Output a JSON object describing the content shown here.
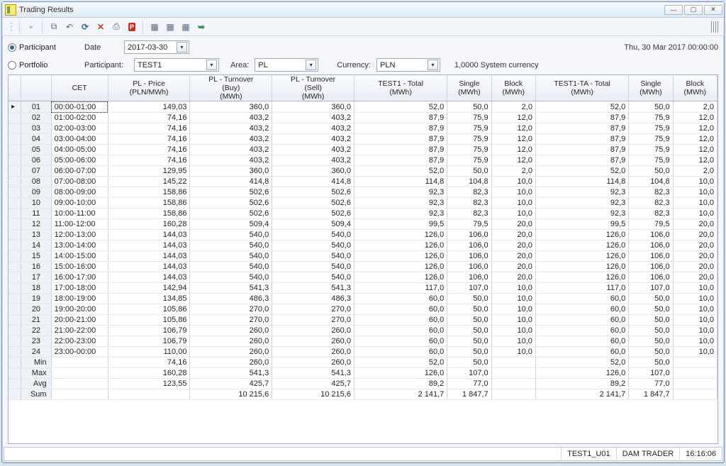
{
  "window": {
    "title": "Trading Results"
  },
  "toolbar": {
    "icons": [
      {
        "name": "new-page-icon",
        "glyph": "▫"
      },
      {
        "name": "copy-icon",
        "glyph": "⧉"
      },
      {
        "name": "undo-icon",
        "glyph": "↶"
      },
      {
        "name": "refresh-icon",
        "glyph": "⟳"
      },
      {
        "name": "delete-icon",
        "glyph": "✕"
      },
      {
        "name": "print-icon",
        "glyph": "⎙"
      },
      {
        "name": "pdf-icon",
        "glyph": "P"
      },
      {
        "name": "export1-icon",
        "glyph": "▦"
      },
      {
        "name": "export2-icon",
        "glyph": "▦"
      },
      {
        "name": "export3-icon",
        "glyph": "▦"
      },
      {
        "name": "send-icon",
        "glyph": "➥"
      }
    ]
  },
  "filter": {
    "participant_label": "Participant",
    "portfolio_label": "Portfolio",
    "date_label": "Date",
    "date_value": "2017-03-30",
    "timestamp": "Thu, 30 Mar 2017 00:00:00",
    "participant_field_label": "Participant:",
    "participant_value": "TEST1",
    "area_label": "Area:",
    "area_value": "PL",
    "currency_label": "Currency:",
    "currency_value": "PLN",
    "sys_currency": "1,0000 System currency"
  },
  "columns": {
    "cet": "CET",
    "price": {
      "l1": "PL - Price",
      "l2": "(PLN/MWh)"
    },
    "buy": {
      "l1": "PL - Turnover",
      "l2": "(Buy)",
      "l3": "(MWh)"
    },
    "sell": {
      "l1": "PL - Turnover",
      "l2": "(Sell)",
      "l3": "(MWh)"
    },
    "ptot": {
      "l1": "TEST1 - Total",
      "l2": "(MWh)"
    },
    "psing": {
      "l1": "Single",
      "l2": "(MWh)"
    },
    "pblk": {
      "l1": "Block",
      "l2": "(MWh)"
    },
    "tatot": {
      "l1": "TEST1-TA - Total",
      "l2": "(MWh)"
    },
    "tasing": {
      "l1": "Single",
      "l2": "(MWh)"
    },
    "tablk": {
      "l1": "Block",
      "l2": "(MWh)"
    }
  },
  "rows": [
    {
      "idx": "01",
      "cet": "00:00-01:00",
      "price": "149,03",
      "buy": "360,0",
      "sell": "360,0",
      "ptot": "52,0",
      "psing": "50,0",
      "pblk": "2,0",
      "tatot": "52,0",
      "tasing": "50,0",
      "tablk": "2,0",
      "selected": true
    },
    {
      "idx": "02",
      "cet": "01:00-02:00",
      "price": "74,16",
      "buy": "403,2",
      "sell": "403,2",
      "ptot": "87,9",
      "psing": "75,9",
      "pblk": "12,0",
      "tatot": "87,9",
      "tasing": "75,9",
      "tablk": "12,0"
    },
    {
      "idx": "03",
      "cet": "02:00-03:00",
      "price": "74,16",
      "buy": "403,2",
      "sell": "403,2",
      "ptot": "87,9",
      "psing": "75,9",
      "pblk": "12,0",
      "tatot": "87,9",
      "tasing": "75,9",
      "tablk": "12,0"
    },
    {
      "idx": "04",
      "cet": "03:00-04:00",
      "price": "74,16",
      "buy": "403,2",
      "sell": "403,2",
      "ptot": "87,9",
      "psing": "75,9",
      "pblk": "12,0",
      "tatot": "87,9",
      "tasing": "75,9",
      "tablk": "12,0"
    },
    {
      "idx": "05",
      "cet": "04:00-05:00",
      "price": "74,16",
      "buy": "403,2",
      "sell": "403,2",
      "ptot": "87,9",
      "psing": "75,9",
      "pblk": "12,0",
      "tatot": "87,9",
      "tasing": "75,9",
      "tablk": "12,0"
    },
    {
      "idx": "06",
      "cet": "05:00-06:00",
      "price": "74,16",
      "buy": "403,2",
      "sell": "403,2",
      "ptot": "87,9",
      "psing": "75,9",
      "pblk": "12,0",
      "tatot": "87,9",
      "tasing": "75,9",
      "tablk": "12,0"
    },
    {
      "idx": "07",
      "cet": "06:00-07:00",
      "price": "129,95",
      "buy": "360,0",
      "sell": "360,0",
      "ptot": "52,0",
      "psing": "50,0",
      "pblk": "2,0",
      "tatot": "52,0",
      "tasing": "50,0",
      "tablk": "2,0"
    },
    {
      "idx": "08",
      "cet": "07:00-08:00",
      "price": "145,22",
      "buy": "414,8",
      "sell": "414,8",
      "ptot": "114,8",
      "psing": "104,8",
      "pblk": "10,0",
      "tatot": "114,8",
      "tasing": "104,8",
      "tablk": "10,0"
    },
    {
      "idx": "09",
      "cet": "08:00-09:00",
      "price": "158,86",
      "buy": "502,6",
      "sell": "502,6",
      "ptot": "92,3",
      "psing": "82,3",
      "pblk": "10,0",
      "tatot": "92,3",
      "tasing": "82,3",
      "tablk": "10,0"
    },
    {
      "idx": "10",
      "cet": "09:00-10:00",
      "price": "158,86",
      "buy": "502,6",
      "sell": "502,6",
      "ptot": "92,3",
      "psing": "82,3",
      "pblk": "10,0",
      "tatot": "92,3",
      "tasing": "82,3",
      "tablk": "10,0"
    },
    {
      "idx": "11",
      "cet": "10:00-11:00",
      "price": "158,86",
      "buy": "502,6",
      "sell": "502,6",
      "ptot": "92,3",
      "psing": "82,3",
      "pblk": "10,0",
      "tatot": "92,3",
      "tasing": "82,3",
      "tablk": "10,0"
    },
    {
      "idx": "12",
      "cet": "11:00-12:00",
      "price": "160,28",
      "buy": "509,4",
      "sell": "509,4",
      "ptot": "99,5",
      "psing": "79,5",
      "pblk": "20,0",
      "tatot": "99,5",
      "tasing": "79,5",
      "tablk": "20,0"
    },
    {
      "idx": "13",
      "cet": "12:00-13:00",
      "price": "144,03",
      "buy": "540,0",
      "sell": "540,0",
      "ptot": "126,0",
      "psing": "106,0",
      "pblk": "20,0",
      "tatot": "126,0",
      "tasing": "106,0",
      "tablk": "20,0"
    },
    {
      "idx": "14",
      "cet": "13:00-14:00",
      "price": "144,03",
      "buy": "540,0",
      "sell": "540,0",
      "ptot": "126,0",
      "psing": "106,0",
      "pblk": "20,0",
      "tatot": "126,0",
      "tasing": "106,0",
      "tablk": "20,0"
    },
    {
      "idx": "15",
      "cet": "14:00-15:00",
      "price": "144,03",
      "buy": "540,0",
      "sell": "540,0",
      "ptot": "126,0",
      "psing": "106,0",
      "pblk": "20,0",
      "tatot": "126,0",
      "tasing": "106,0",
      "tablk": "20,0"
    },
    {
      "idx": "16",
      "cet": "15:00-16:00",
      "price": "144,03",
      "buy": "540,0",
      "sell": "540,0",
      "ptot": "126,0",
      "psing": "106,0",
      "pblk": "20,0",
      "tatot": "126,0",
      "tasing": "106,0",
      "tablk": "20,0"
    },
    {
      "idx": "17",
      "cet": "16:00-17:00",
      "price": "144,03",
      "buy": "540,0",
      "sell": "540,0",
      "ptot": "126,0",
      "psing": "106,0",
      "pblk": "20,0",
      "tatot": "126,0",
      "tasing": "106,0",
      "tablk": "20,0"
    },
    {
      "idx": "18",
      "cet": "17:00-18:00",
      "price": "142,94",
      "buy": "541,3",
      "sell": "541,3",
      "ptot": "117,0",
      "psing": "107,0",
      "pblk": "10,0",
      "tatot": "117,0",
      "tasing": "107,0",
      "tablk": "10,0"
    },
    {
      "idx": "19",
      "cet": "18:00-19:00",
      "price": "134,85",
      "buy": "486,3",
      "sell": "486,3",
      "ptot": "60,0",
      "psing": "50,0",
      "pblk": "10,0",
      "tatot": "60,0",
      "tasing": "50,0",
      "tablk": "10,0"
    },
    {
      "idx": "20",
      "cet": "19:00-20:00",
      "price": "105,86",
      "buy": "270,0",
      "sell": "270,0",
      "ptot": "60,0",
      "psing": "50,0",
      "pblk": "10,0",
      "tatot": "60,0",
      "tasing": "50,0",
      "tablk": "10,0"
    },
    {
      "idx": "21",
      "cet": "20:00-21:00",
      "price": "105,86",
      "buy": "270,0",
      "sell": "270,0",
      "ptot": "60,0",
      "psing": "50,0",
      "pblk": "10,0",
      "tatot": "60,0",
      "tasing": "50,0",
      "tablk": "10,0"
    },
    {
      "idx": "22",
      "cet": "21:00-22:00",
      "price": "106,79",
      "buy": "260,0",
      "sell": "260,0",
      "ptot": "60,0",
      "psing": "50,0",
      "pblk": "10,0",
      "tatot": "60,0",
      "tasing": "50,0",
      "tablk": "10,0"
    },
    {
      "idx": "23",
      "cet": "22:00-23:00",
      "price": "106,79",
      "buy": "260,0",
      "sell": "260,0",
      "ptot": "60,0",
      "psing": "50,0",
      "pblk": "10,0",
      "tatot": "60,0",
      "tasing": "50,0",
      "tablk": "10,0"
    },
    {
      "idx": "24",
      "cet": "23:00-00:00",
      "price": "110,00",
      "buy": "260,0",
      "sell": "260,0",
      "ptot": "60,0",
      "psing": "50,0",
      "pblk": "10,0",
      "tatot": "60,0",
      "tasing": "50,0",
      "tablk": "10,0"
    }
  ],
  "summary": [
    {
      "idx": "Min",
      "cet": "",
      "price": "74,16",
      "buy": "260,0",
      "sell": "260,0",
      "ptot": "52,0",
      "psing": "50,0",
      "pblk": "",
      "tatot": "52,0",
      "tasing": "50,0",
      "tablk": ""
    },
    {
      "idx": "Max",
      "cet": "",
      "price": "160,28",
      "buy": "541,3",
      "sell": "541,3",
      "ptot": "126,0",
      "psing": "107,0",
      "pblk": "",
      "tatot": "126,0",
      "tasing": "107,0",
      "tablk": ""
    },
    {
      "idx": "Avg",
      "cet": "",
      "price": "123,55",
      "buy": "425,7",
      "sell": "425,7",
      "ptot": "89,2",
      "psing": "77,0",
      "pblk": "",
      "tatot": "89,2",
      "tasing": "77,0",
      "tablk": ""
    },
    {
      "idx": "Sum",
      "cet": "",
      "price": "",
      "buy": "10 215,6",
      "sell": "10 215,6",
      "ptot": "2 141,7",
      "psing": "1 847,7",
      "pblk": "",
      "tatot": "2 141,7",
      "tasing": "1 847,7",
      "tablk": ""
    }
  ],
  "status": {
    "user": "TEST1_U01",
    "role": "DAM TRADER",
    "time": "16:16:06"
  }
}
